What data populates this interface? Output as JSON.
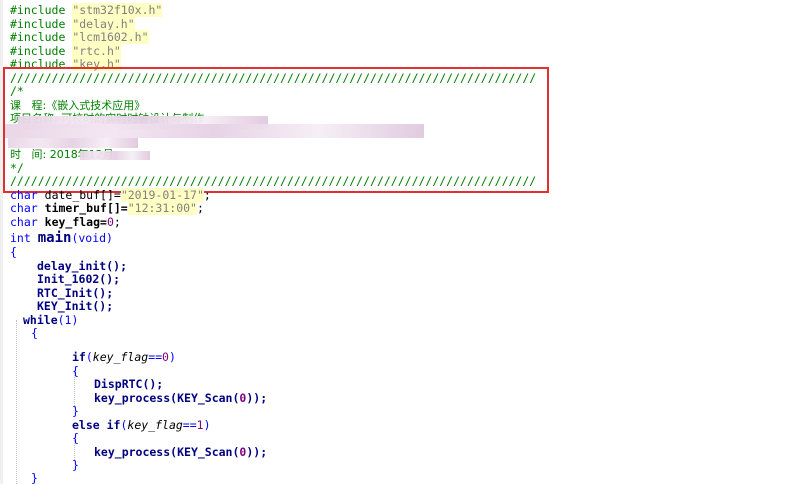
{
  "includes": [
    {
      "directive": "#include",
      "file": "\"stm32f10x.h\""
    },
    {
      "directive": "#include",
      "file": "\"delay.h\""
    },
    {
      "directive": "#include",
      "file": "\"lcm1602.h\""
    },
    {
      "directive": "#include",
      "file": "\"rtc.h\""
    },
    {
      "directive": "#include",
      "file": "\"key.h\""
    }
  ],
  "comment_block": {
    "divider": "////////////////////////////////////////////////////////////////////////////",
    "open": "/*",
    "course": "课   程:《嵌入式技术应用》",
    "project": "项目名称: 可校时的实时时钟设计与制作",
    "time": "时   间: 2018年12月",
    "close": "*/"
  },
  "globals": [
    {
      "type": "char",
      "name": "date_buf[]=",
      "value": "\"2019-01-17\"",
      "end": ";"
    },
    {
      "type": "char",
      "name": "timer_buf[]=",
      "value": "\"12:31:00\"",
      "end": ";"
    },
    {
      "type": "char",
      "name": "key_flag=",
      "value": "0",
      "end": ";"
    }
  ],
  "main_sig": {
    "type": "int",
    "name": "main",
    "args": "(void)"
  },
  "body": {
    "open_brace": "{",
    "calls": [
      "delay_init();",
      "Init_1602();",
      "RTC_Init();",
      "KEY_Init();"
    ],
    "while_kw": "while",
    "while_cond": "(1)",
    "while_brace": "{",
    "if_kw": "if",
    "if_cond_a": "(",
    "if_var": "key_flag",
    "if_cond_b": "==",
    "if_val": "0",
    "if_cond_c": ")",
    "if_open": "{",
    "disp": "DispRTC();",
    "kp1_a": "key_process(",
    "kp1_b": "KEY_Scan(",
    "kp1_c": "0",
    "kp1_d": "));",
    "if_close": "}",
    "else_kw": "else if",
    "else_cond_a": "(",
    "else_var": "key_flag",
    "else_cond_b": "==",
    "else_val": "1",
    "else_cond_c": ")",
    "else_open": "{",
    "kp2_a": "key_process(",
    "kp2_b": "KEY_Scan(",
    "kp2_c": "0",
    "kp2_d": "));",
    "else_close": "}",
    "while_close": "}"
  }
}
